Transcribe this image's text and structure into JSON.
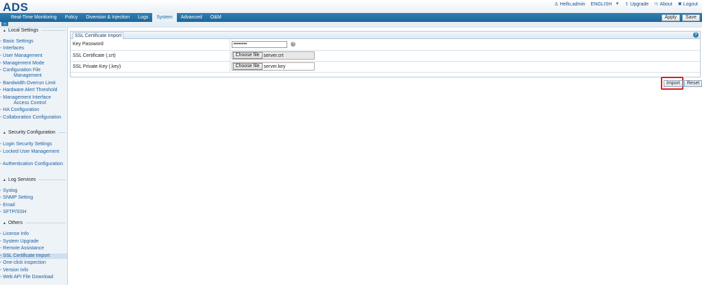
{
  "app": {
    "logo": "ADS"
  },
  "user_links": {
    "hello": "Hello,admin",
    "language": "ENGLISH",
    "upgrade": "Upgrade",
    "about": "About",
    "logout": "Logout"
  },
  "nav": {
    "tabs": [
      {
        "label": "Real-Time Monitoring",
        "active": false
      },
      {
        "label": "Policy",
        "active": false
      },
      {
        "label": "Diversion & Injection",
        "active": false
      },
      {
        "label": "Logs",
        "active": false
      },
      {
        "label": "System",
        "active": true
      },
      {
        "label": "Advanced",
        "active": false
      },
      {
        "label": "O&M",
        "active": false
      }
    ],
    "apply_label": "Apply",
    "save_label": "Save"
  },
  "sidebar": {
    "sections": [
      {
        "title": "Local Settings",
        "items": [
          "Basic Settings",
          "Interfaces",
          "User Management",
          "Management Mode",
          "Configuration File Management",
          "Bandwidth Overrun Limit",
          "Hardware Alert Threshold",
          "Management Interface Access Control",
          "HA Configuration",
          "Collaboration Configuration"
        ]
      },
      {
        "title": "Security Configuration",
        "items": [
          "Login Security Settings",
          "Locked User Management",
          "Authentication Configuration"
        ]
      },
      {
        "title": "Log Services",
        "items": [
          "Syslog",
          "SNMP Setting",
          "Email",
          "SFTP/SSH"
        ]
      },
      {
        "title": "Others",
        "items": [
          "License Info",
          "System Upgrade",
          "Remote Assistance",
          "SSL Certificate Import",
          "One-click inspection",
          "Version Info",
          "Web API File Download"
        ]
      }
    ],
    "selected": "SSL Certificate Import"
  },
  "panel": {
    "title": "SSL Certificate Import",
    "rows": [
      {
        "label": "Key Password",
        "value": "••••••••"
      },
      {
        "label": "SSL Certificate (.crt)",
        "button": "Choose file",
        "file": "server.crt"
      },
      {
        "label": "SSL Private Key (.key)",
        "button": "Choose file",
        "file": "server.key"
      }
    ],
    "import_label": "Import",
    "reset_label": "Reset"
  }
}
